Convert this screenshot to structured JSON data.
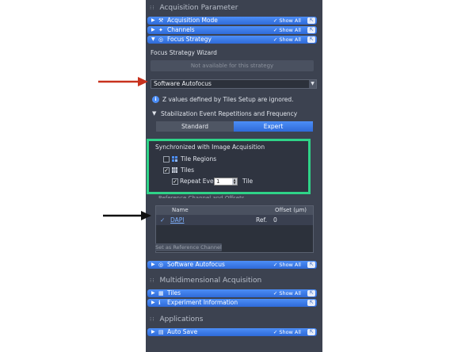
{
  "acquisition_parameter": {
    "title": "Acquisition Parameter",
    "bars": [
      {
        "label": "Acquisition Mode",
        "icon": "wrench-icon",
        "show_all": "Show All"
      },
      {
        "label": "Channels",
        "icon": "channels-icon",
        "show_all": "Show All"
      },
      {
        "label": "Focus Strategy",
        "icon": "focus-icon",
        "show_all": "Show All"
      }
    ]
  },
  "focus_strategy": {
    "wizard_label": "Focus Strategy Wizard",
    "wizard_button": "Not available for this strategy",
    "strategy_selected": "Software Autofocus",
    "info_text": "Z values defined by Tiles Setup are ignored.",
    "stabilization_label": "Stabilization Event Repetitions and Frequency",
    "segments": [
      "Standard",
      "Expert"
    ],
    "active_segment": "Expert",
    "sync": {
      "title": "Synchronized with Image Acquisition",
      "tile_regions_label": "Tile Regions",
      "tile_regions_checked": false,
      "tiles_label": "Tiles",
      "tiles_checked": true,
      "repeat_label": "Repeat Every",
      "repeat_checked": true,
      "repeat_value": "1",
      "repeat_unit": "Tile"
    },
    "reference": {
      "title": "Reference Channel and Offsets",
      "columns": [
        "Name",
        "Offset (µm)"
      ],
      "rows": [
        {
          "name": "DAPI",
          "ref": "Ref.",
          "offset": "0"
        }
      ],
      "set_reference_button": "Set as Reference Channel"
    },
    "software_autofocus_bar": {
      "label": "Software Autofocus",
      "show_all": "Show All"
    }
  },
  "multidimensional": {
    "title": "Multidimensional Acquisition",
    "bars": [
      {
        "label": "Tiles",
        "icon": "tiles-icon",
        "show_all": "Show All"
      },
      {
        "label": "Experiment Information",
        "icon": "info-icon",
        "show_all": ""
      }
    ]
  },
  "applications": {
    "title": "Applications",
    "bars": [
      {
        "label": "Auto Save",
        "icon": "save-icon",
        "show_all": "Show All"
      }
    ]
  },
  "colors": {
    "panel_bg": "#3c4250",
    "accent_blue": "#3a7ef0",
    "highlight_green": "#2fd388",
    "annotation_red": "#c8321e"
  }
}
